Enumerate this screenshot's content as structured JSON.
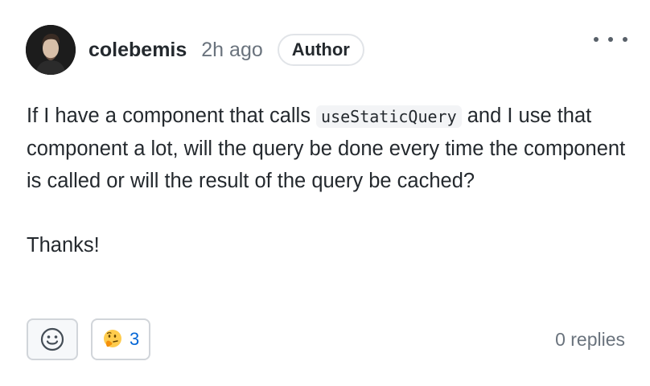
{
  "comment": {
    "author": "colebemis",
    "time": "2h ago",
    "badge": "Author",
    "body_part1": "If I have a component that calls ",
    "body_code": "useStaticQuery",
    "body_part2": " and I use that component a lot, will the query be done every time the component is called or will the result of the query be cached?",
    "body_thanks": "Thanks!"
  },
  "reactions": [
    {
      "icon": "thinking-face-emoji",
      "count": "3"
    }
  ],
  "footer": {
    "replies": "0 replies"
  },
  "colors": {
    "text": "#24292e",
    "muted": "#6a737d",
    "link": "#0366d6",
    "border": "#d1d5da"
  }
}
